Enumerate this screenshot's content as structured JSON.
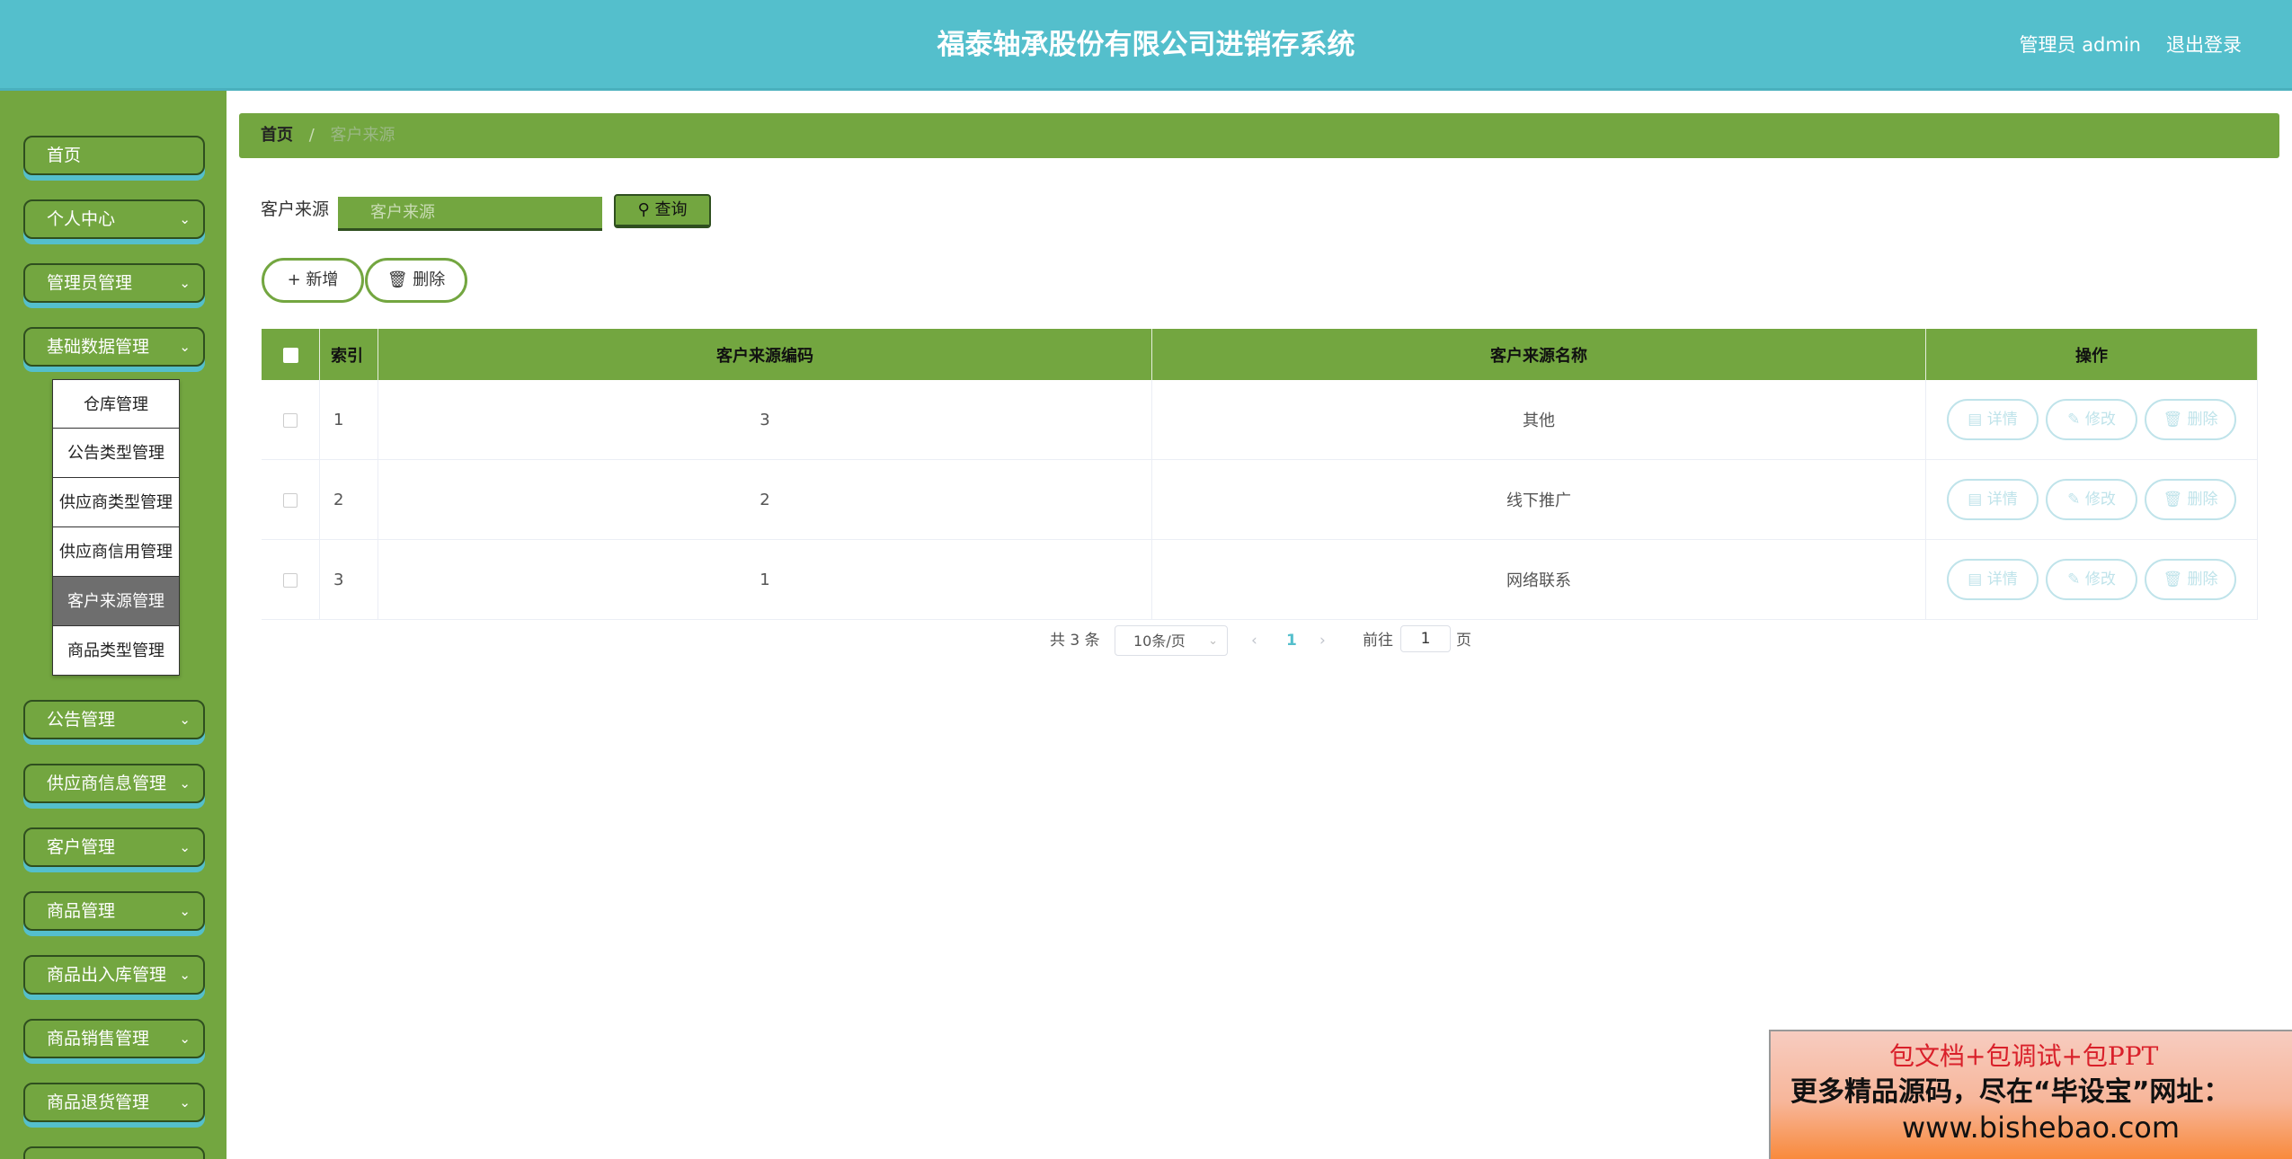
{
  "header": {
    "title": "福泰轴承股份有限公司进销存系统",
    "user": "管理员 admin",
    "logout": "退出登录"
  },
  "sidebar": {
    "items": [
      {
        "label": "首页",
        "has_chevron": false
      },
      {
        "label": "个人中心",
        "has_chevron": true
      },
      {
        "label": "管理员管理",
        "has_chevron": true
      },
      {
        "label": "基础数据管理",
        "has_chevron": true
      },
      {
        "label": "公告管理",
        "has_chevron": true
      },
      {
        "label": "供应商信息管理",
        "has_chevron": true
      },
      {
        "label": "客户管理",
        "has_chevron": true
      },
      {
        "label": "商品管理",
        "has_chevron": true
      },
      {
        "label": "商品出入库管理",
        "has_chevron": true
      },
      {
        "label": "商品销售管理",
        "has_chevron": true
      },
      {
        "label": "商品退货管理",
        "has_chevron": true
      }
    ],
    "submenu": [
      {
        "label": "仓库管理"
      },
      {
        "label": "公告类型管理"
      },
      {
        "label": "供应商类型管理"
      },
      {
        "label": "供应商信用管理"
      },
      {
        "label": "客户来源管理",
        "active": true
      },
      {
        "label": "商品类型管理"
      }
    ]
  },
  "breadcrumb": {
    "home": "首页",
    "separator": "/",
    "current": "客户来源"
  },
  "search": {
    "label": "客户来源",
    "placeholder": "客户来源",
    "button": "查询"
  },
  "actions": {
    "add": "新增",
    "delete": "删除"
  },
  "table": {
    "headers": {
      "index": "索引",
      "code": "客户来源编码",
      "name": "客户来源名称",
      "ops": "操作"
    },
    "rows": [
      {
        "index": "1",
        "code": "3",
        "name": "其他"
      },
      {
        "index": "2",
        "code": "2",
        "name": "线下推广"
      },
      {
        "index": "3",
        "code": "1",
        "name": "网络联系"
      }
    ],
    "op_labels": {
      "detail": "详情",
      "edit": "修改",
      "delete": "删除"
    }
  },
  "pagination": {
    "total": "共 3 条",
    "page_size": "10条/页",
    "current_page": "1",
    "goto_prefix": "前往",
    "goto_value": "1",
    "goto_suffix": "页"
  },
  "watermark": {
    "line1": "包文档+包调试+包PPT",
    "line2": "更多精品源码，尽在“毕设宝”网址：",
    "line3": "www.bishebao.com"
  },
  "colors": {
    "header": "#54bfcc",
    "sidebar": "#73a640",
    "accent": "#73a640",
    "border_dark": "#2f4f1f"
  }
}
